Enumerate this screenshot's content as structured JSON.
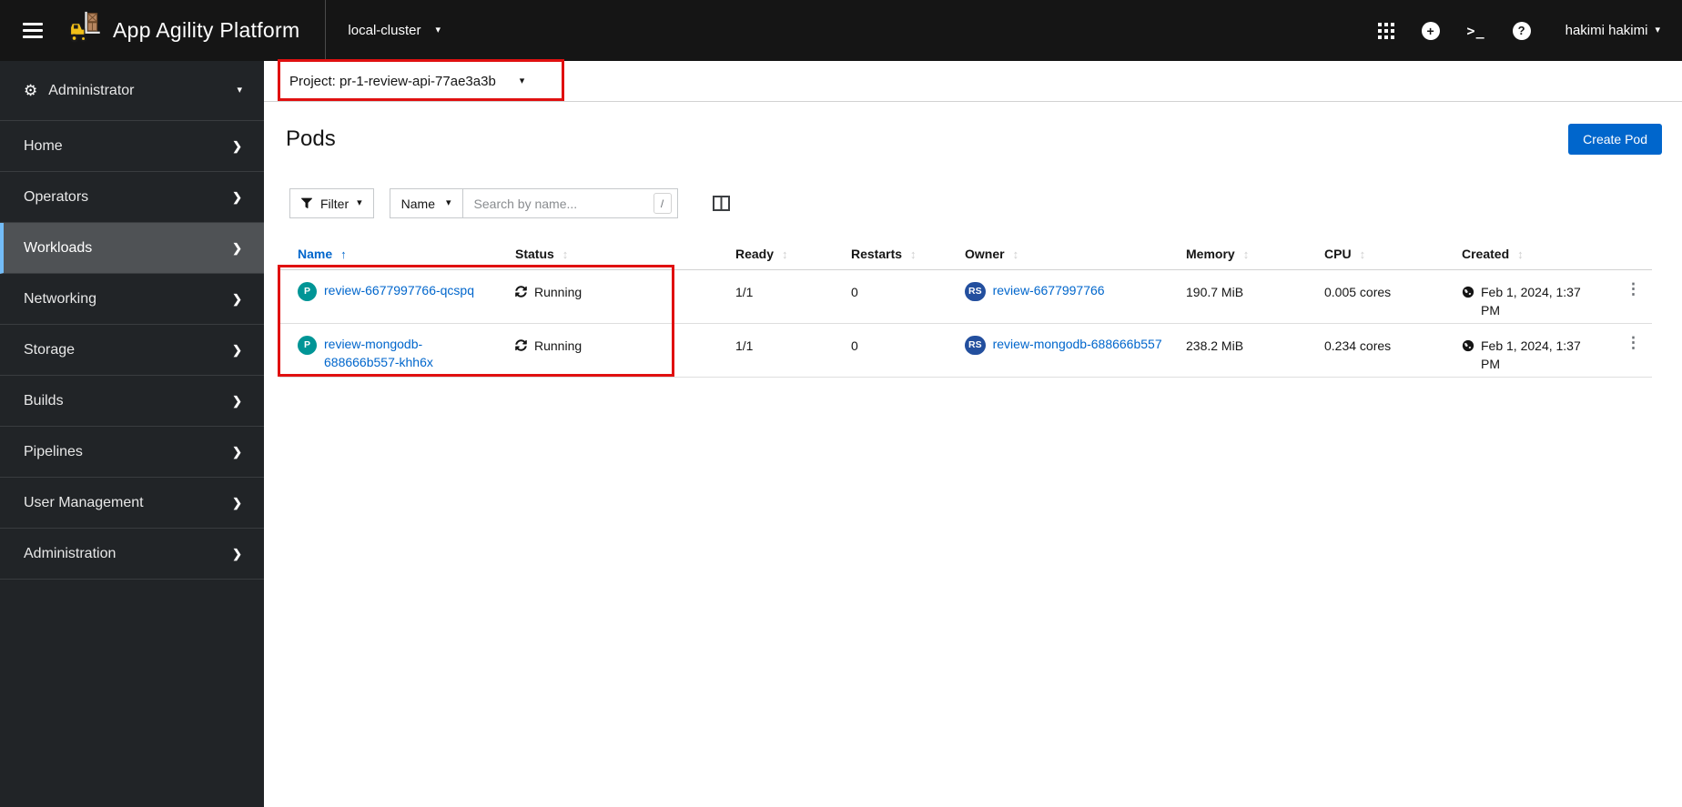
{
  "masthead": {
    "brand": "App Agility Platform",
    "cluster": "local-cluster",
    "user": "hakimi hakimi"
  },
  "sidebar": {
    "perspective": {
      "label": "Administrator"
    },
    "items": [
      {
        "label": "Home",
        "active": false
      },
      {
        "label": "Operators",
        "active": false
      },
      {
        "label": "Workloads",
        "active": true
      },
      {
        "label": "Networking",
        "active": false
      },
      {
        "label": "Storage",
        "active": false
      },
      {
        "label": "Builds",
        "active": false
      },
      {
        "label": "Pipelines",
        "active": false
      },
      {
        "label": "User Management",
        "active": false
      },
      {
        "label": "Administration",
        "active": false
      }
    ]
  },
  "project_bar": {
    "label": "Project: pr-1-review-api-77ae3a3b"
  },
  "page": {
    "title": "Pods",
    "create_button": "Create Pod"
  },
  "toolbar": {
    "filter_label": "Filter",
    "filter_type": "Name",
    "search_placeholder": "Search by name...",
    "search_shortcut": "/"
  },
  "table": {
    "columns": [
      {
        "label": "Name",
        "sort": "asc"
      },
      {
        "label": "Status",
        "sort": "none"
      },
      {
        "label": "Ready",
        "sort": "none"
      },
      {
        "label": "Restarts",
        "sort": "none"
      },
      {
        "label": "Owner",
        "sort": "none"
      },
      {
        "label": "Memory",
        "sort": "none"
      },
      {
        "label": "CPU",
        "sort": "none"
      },
      {
        "label": "Created",
        "sort": "none"
      }
    ],
    "rows": [
      {
        "badge": "P",
        "name": "review-6677997766-qcspq",
        "status": "Running",
        "ready": "1/1",
        "restarts": "0",
        "owner_badge": "RS",
        "owner": "review-6677997766",
        "memory": "190.7 MiB",
        "cpu": "0.005 cores",
        "created": "Feb 1, 2024, 1:37 PM"
      },
      {
        "badge": "P",
        "name": "review-mongodb-688666b557-khh6x",
        "status": "Running",
        "ready": "1/1",
        "restarts": "0",
        "owner_badge": "RS",
        "owner": "review-mongodb-688666b557",
        "memory": "238.2 MiB",
        "cpu": "0.234 cores",
        "created": "Feb 1, 2024, 1:37 PM"
      }
    ]
  },
  "icons": {
    "caret_down": "▾",
    "chevron_right": "❯",
    "cogs": "⚙",
    "kebab": "⋮",
    "sort_asc": "↑",
    "sort_both": "↕",
    "plus": "+",
    "help": "?",
    "terminal": ">_"
  },
  "colors": {
    "accent": "#0066cc",
    "masthead_bg": "#151515",
    "sidebar_bg": "#212427",
    "sidebar_active_bg": "#4f5255",
    "sidebar_active_accent": "#73bcf7",
    "pod_badge": "#009596",
    "replicaset_badge": "#234f9e",
    "annotation": "#e01010"
  }
}
